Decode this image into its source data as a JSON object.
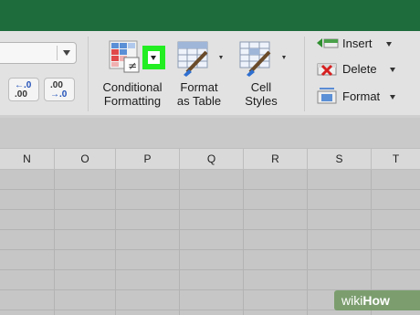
{
  "ribbon": {
    "number_format_value": "",
    "increase_decimal": {
      "top": "←.0",
      "bottom": ".00"
    },
    "decrease_decimal": {
      "top": ".00",
      "bottom": "→.0"
    },
    "conditional_formatting": {
      "line1": "Conditional",
      "line2": "Formatting",
      "icon": "conditional-formatting-icon"
    },
    "format_as_table": {
      "line1": "Format",
      "line2": "as Table",
      "icon": "format-as-table-icon"
    },
    "cell_styles": {
      "line1": "Cell",
      "line2": "Styles",
      "icon": "cell-styles-icon"
    },
    "insert": {
      "label": "Insert",
      "icon": "insert-icon"
    },
    "delete": {
      "label": "Delete",
      "icon": "delete-icon"
    },
    "format": {
      "label": "Format",
      "icon": "format-cells-icon"
    },
    "highlight_color": "#22ee22"
  },
  "sheet": {
    "columns": [
      "N",
      "O",
      "P",
      "Q",
      "R",
      "S",
      "T"
    ]
  },
  "watermark": {
    "prefix": "wiki",
    "suffix": "How"
  }
}
